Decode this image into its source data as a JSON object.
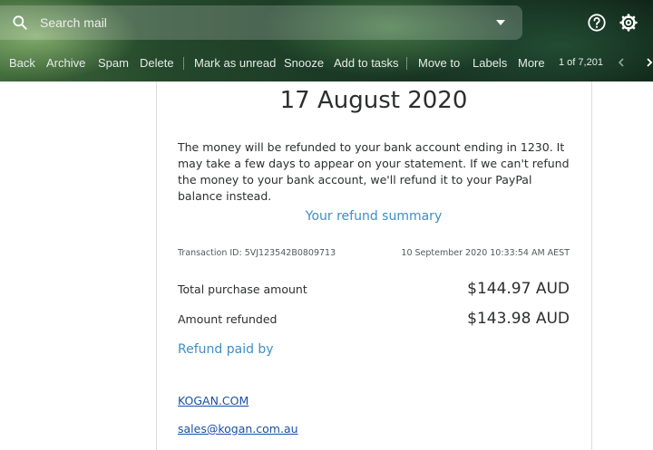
{
  "search": {
    "placeholder": "Search mail"
  },
  "header_icons": [
    "search-icon",
    "search-options-icon",
    "help-icon",
    "gear-icon"
  ],
  "toolbar": {
    "back": "Back",
    "archive": "Archive",
    "spam": "Spam",
    "delete": "Delete",
    "mark_unread": "Mark as unread",
    "snooze": "Snooze",
    "add_tasks": "Add to tasks",
    "move_to": "Move to",
    "labels": "Labels",
    "more": "More",
    "count": "1 of 7,201"
  },
  "email": {
    "date_heading": "17 August 2020",
    "paragraph": "The money will be refunded to your bank account ending in 1230. It may take a few days to appear on your statement. If we can't refund the money to your bank account, we'll refund it to your PayPal balance instead.",
    "summary_title": "Your refund summary",
    "transaction_id": "Transaction ID: 5VJ123542B0809713",
    "transaction_date": "10 September 2020 10:33:54 AM AEST",
    "rows": [
      {
        "label": "Total purchase amount",
        "value": "$144.97 AUD"
      },
      {
        "label": "Amount refunded",
        "value": "$143.98 AUD"
      }
    ],
    "refund_paid_by": "Refund paid by",
    "merchant_name": "KOGAN.COM",
    "merchant_email": "sales@kogan.com.au"
  },
  "colors": {
    "link_blue": "#1a4fa5",
    "accent_blue": "#3d8fc4",
    "text": "#2c2e2f"
  }
}
